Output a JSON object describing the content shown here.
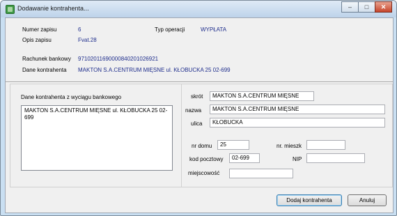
{
  "window": {
    "title": "Dodawanie kontrahenta..."
  },
  "header": {
    "numer_label": "Numer zapisu",
    "numer_value": "6",
    "typ_label": "Typ operacji",
    "typ_value": "WYPŁATA",
    "opis_label": "Opis zapisu",
    "opis_value": "Fvat.28",
    "rachunek_label": "Rachunek bankowy",
    "rachunek_value": "97102011690000840201026921",
    "dane_label": "Dane kontrahenta",
    "dane_value": "MAKTON S.A.CENTRUM MIĘSNE ul. KŁOBUCKA 25 02-699"
  },
  "left_panel": {
    "label": "Dane kontrahenta z wyciągu bankowego",
    "text": "MAKTON S.A.CENTRUM MIĘSNE ul. KŁOBUCKA 25 02-699"
  },
  "form": {
    "skrot_label": "skrót",
    "skrot_value": "MAKTON S.A.CENTRUM MIĘSNE",
    "nazwa_label": "nazwa",
    "nazwa_value": "MAKTON S.A.CENTRUM MIĘSNE",
    "ulica_label": "ulica",
    "ulica_value": "KŁOBUCKA",
    "nr_domu_label": "nr domu",
    "nr_domu_value": "25",
    "nr_mieszk_label": "nr. mieszk",
    "nr_mieszk_value": "",
    "kod_label": "kod pocztowy",
    "kod_value": "02-699",
    "nip_label": "NIP",
    "nip_value": "",
    "miejscowosc_label": "miejscowość",
    "miejscowosc_value": ""
  },
  "buttons": {
    "dodaj": "Dodaj kontrahenta",
    "anuluj": "Anuluj"
  }
}
